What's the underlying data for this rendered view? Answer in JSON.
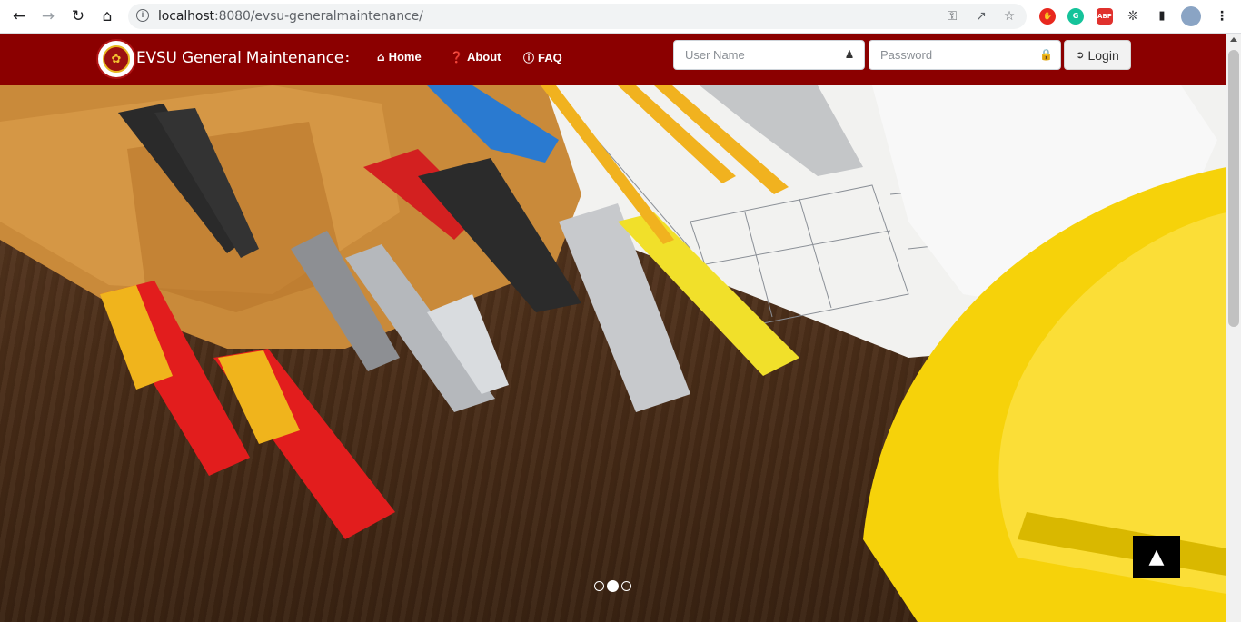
{
  "browser": {
    "url_host": "localhost",
    "url_rest": ":8080/evsu-generalmaintenance/",
    "ext_abp": "ABP"
  },
  "header": {
    "brand": "EVSU General Maintenance",
    "separator": ":",
    "nav": [
      {
        "label": "Home",
        "icon": "home-icon"
      },
      {
        "label": "About",
        "icon": "question-circle-icon"
      },
      {
        "label": "FAQ",
        "icon": "info-circle-icon"
      }
    ],
    "username_placeholder": "User Name",
    "password_placeholder": "Password",
    "login_label": "Login"
  },
  "carousel": {
    "slide_count": 3,
    "active_index": 1
  },
  "colors": {
    "header_bg": "#8b0000",
    "helmet_yellow": "#f6d20a"
  }
}
